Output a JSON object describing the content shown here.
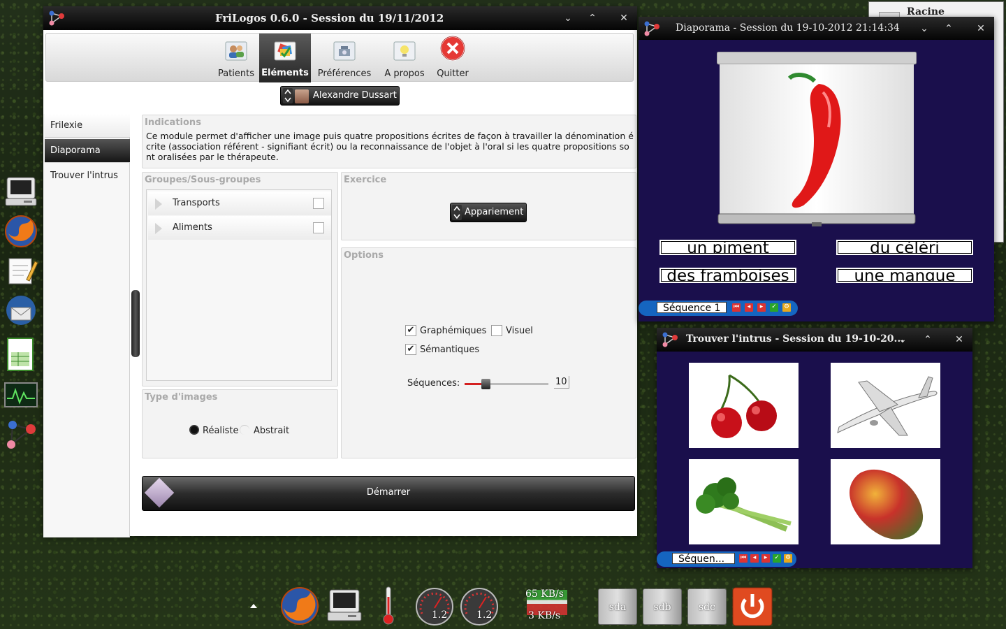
{
  "colors": {
    "slideshow_bg": "#1a0f4c",
    "close_red": "#e53935",
    "slider_fill": "#d42020",
    "sequence_bar_blue": "#1565c0"
  },
  "background_window": {
    "title": "Racine"
  },
  "main_window": {
    "title": "FriLogos 0.6.0 - Session du 19/11/2012",
    "controls": {
      "minimize": "⌄",
      "maximize": "⌃",
      "close": "✕"
    },
    "toolbar": [
      {
        "label": "Patients",
        "icon": "patients-icon"
      },
      {
        "label": "Eléments",
        "icon": "elements-icon",
        "active": true
      },
      {
        "label": "Préférences",
        "icon": "preferences-icon"
      },
      {
        "label": "A propos",
        "icon": "about-icon"
      },
      {
        "label": "Quitter",
        "icon": "quit-icon"
      }
    ],
    "patient": {
      "name": "Alexandre Dussart"
    },
    "modules": [
      {
        "label": "Frilexie"
      },
      {
        "label": "Diaporama",
        "active": true
      },
      {
        "label": "Trouver l'intrus"
      }
    ],
    "indications": {
      "title": "Indications",
      "text": "Ce module permet d'afficher une image puis quatre propositions écrites de façon à travailler la dénomination écrite (association référent - signifiant écrit) ou la reconnaissance de l'objet à l'oral si les quatre propositions sont oralisées par le thérapeute."
    },
    "groups": {
      "title": "Groupes/Sous-groupes",
      "items": [
        {
          "label": "Transports",
          "checked": false
        },
        {
          "label": "Aliments",
          "checked": false
        }
      ]
    },
    "exercise": {
      "title": "Exercice",
      "value": "Appariement"
    },
    "options": {
      "title": "Options",
      "graphemiques": {
        "label": "Graphémiques",
        "checked": true
      },
      "visuel": {
        "label": "Visuel",
        "checked": false
      },
      "semantiques": {
        "label": "Sémantiques",
        "checked": true
      },
      "sequences": {
        "label": "Séquences:",
        "value": "10",
        "level": 0.25
      }
    },
    "image_type": {
      "title": "Type d'images",
      "realiste": {
        "label": "Réaliste",
        "selected": true
      },
      "abstrait": {
        "label": "Abstrait",
        "selected": false
      }
    },
    "start": {
      "label": "Démarrer"
    }
  },
  "slideshow_window": {
    "title": "Diaporama - Session du 19-10-2012 21:14:34",
    "image": "red-chili-pepper",
    "choices": [
      "un piment",
      "du célèri",
      "des framboises",
      "une mangue"
    ],
    "sequence_label": "Séquence 1"
  },
  "intrus_window": {
    "title": "Trouver l'intrus - Session du 19-10-20...",
    "images": [
      "cherries",
      "airplane",
      "celery",
      "mango"
    ],
    "sequence_label": "Séquen..."
  },
  "left_dock": [
    "computer-icon",
    "firefox-icon",
    "text-editor-icon",
    "thunderbird-icon",
    "spreadsheet-icon",
    "system-monitor-icon",
    "frilogos-icon"
  ],
  "bottom_panel": {
    "cpu1": "1.2",
    "cpu2": "1.2",
    "net_down": "65 KB/s",
    "net_up": "3 KB/s",
    "drives": [
      "sda",
      "sdb",
      "sdc"
    ]
  }
}
